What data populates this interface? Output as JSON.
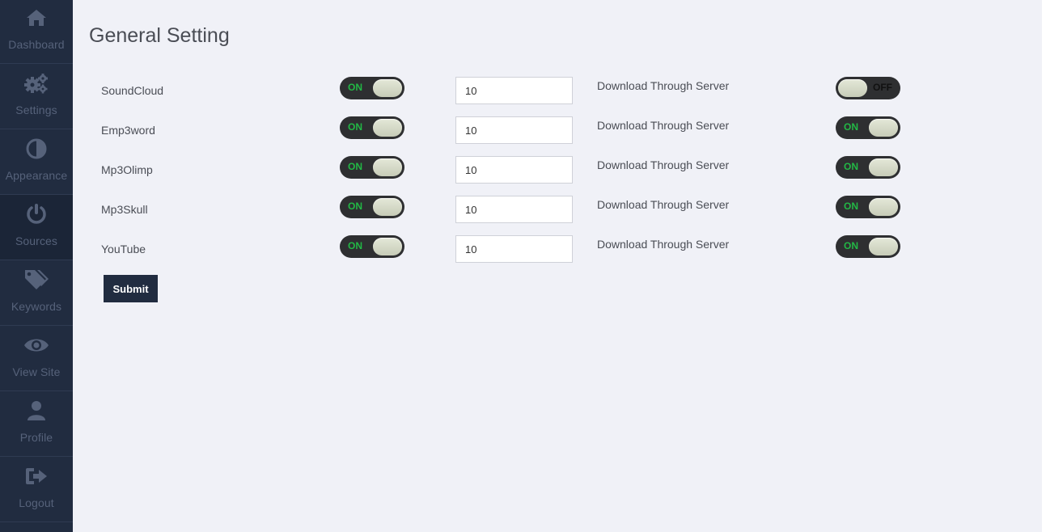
{
  "sidebar": {
    "items": [
      {
        "label": "Dashboard",
        "icon": "home-icon"
      },
      {
        "label": "Settings",
        "icon": "gears-icon"
      },
      {
        "label": "Appearance",
        "icon": "contrast-icon"
      },
      {
        "label": "Sources",
        "icon": "power-icon"
      },
      {
        "label": "Keywords",
        "icon": "tags-icon"
      },
      {
        "label": "View Site",
        "icon": "eye-icon"
      },
      {
        "label": "Profile",
        "icon": "user-icon"
      },
      {
        "label": "Logout",
        "icon": "sign-out-icon"
      }
    ],
    "active": "Sources"
  },
  "page": {
    "title": "General Setting"
  },
  "sources": [
    {
      "name": "SoundCloud",
      "enabled": "ON",
      "count": "10",
      "server_label": "Download Through Server",
      "server": "OFF"
    },
    {
      "name": "Emp3word",
      "enabled": "ON",
      "count": "10",
      "server_label": "Download Through Server",
      "server": "ON"
    },
    {
      "name": "Mp3Olimp",
      "enabled": "ON",
      "count": "10",
      "server_label": "Download Through Server",
      "server": "ON"
    },
    {
      "name": "Mp3Skull",
      "enabled": "ON",
      "count": "10",
      "server_label": "Download Through Server",
      "server": "ON"
    },
    {
      "name": "YouTube",
      "enabled": "ON",
      "count": "10",
      "server_label": "Download Through Server",
      "server": "ON"
    }
  ],
  "form": {
    "submit_label": "Submit"
  },
  "colors": {
    "sidebar_bg": "#212c40",
    "page_bg": "#f0f1f7",
    "toggle_on_text": "#22b845",
    "submit_bg": "#212c40"
  }
}
